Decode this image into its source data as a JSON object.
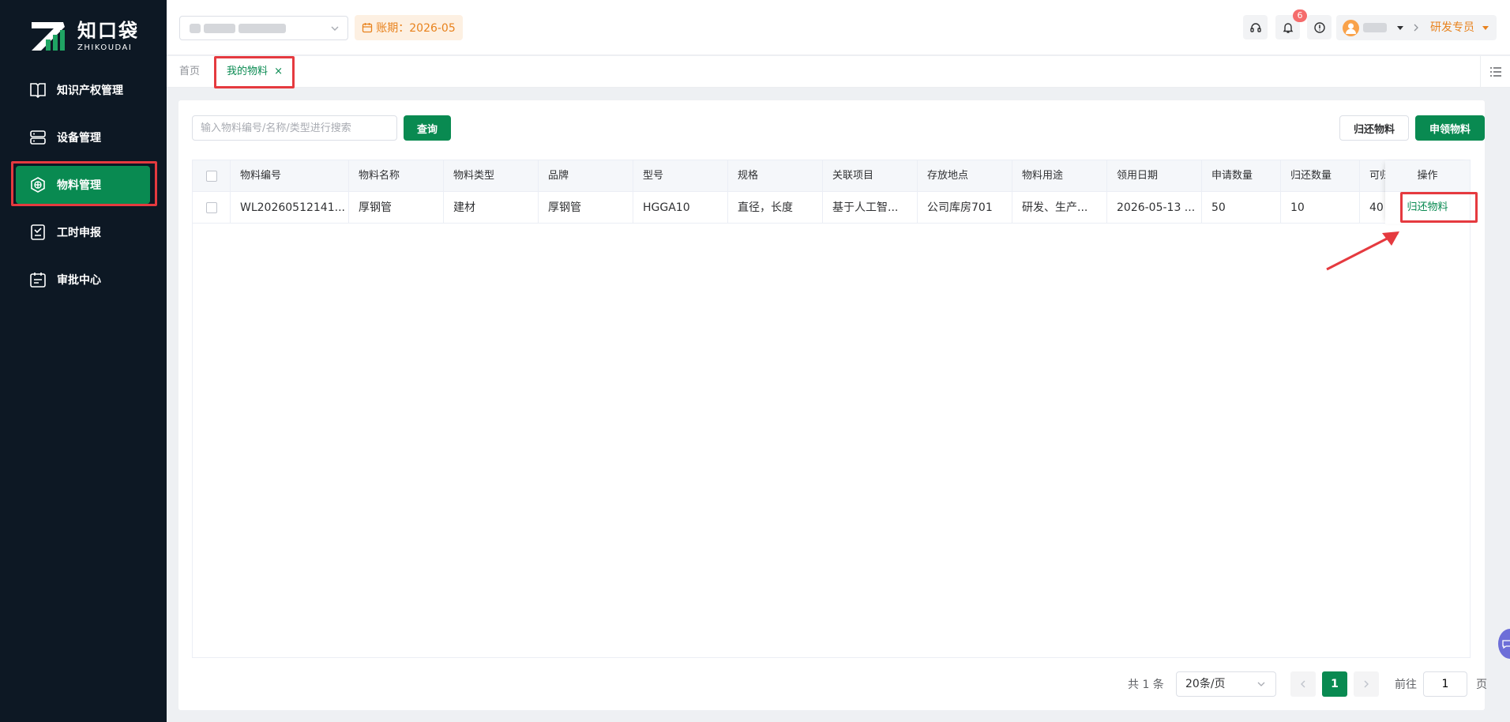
{
  "sidebar": {
    "logo_text": "知口袋",
    "logo_sub": "ZHIKOUDAI",
    "items": [
      {
        "label": "知识产权管理",
        "icon": "book-icon"
      },
      {
        "label": "设备管理",
        "icon": "server-icon"
      },
      {
        "label": "物料管理",
        "icon": "box-icon",
        "active": true
      },
      {
        "label": "工时申报",
        "icon": "clock-icon"
      },
      {
        "label": "审批中心",
        "icon": "calendar-check-icon"
      }
    ]
  },
  "header": {
    "period": "账期：2026-05",
    "notification_count": "6",
    "role": "研发专员"
  },
  "tabs": {
    "home": "首页",
    "active": "我的物料",
    "close": "×"
  },
  "toolbar": {
    "search_placeholder": "输入物料编号/名称/类型进行搜索",
    "search_button": "查询",
    "return_button": "归还物料",
    "apply_button": "申领物料"
  },
  "table": {
    "columns": [
      "物料编号",
      "物料名称",
      "物料类型",
      "品牌",
      "型号",
      "规格",
      "关联项目",
      "存放地点",
      "物料用途",
      "领用日期",
      "申请数量",
      "归还数量",
      "可归"
    ],
    "action_header": "操作",
    "rows": [
      {
        "cells": [
          "WL20260512141...",
          "厚钢管",
          "建材",
          "厚钢管",
          "HGGA10",
          "直径，长度",
          "基于人工智...",
          "公司库房701",
          "研发、生产...",
          "2026-05-13 ...",
          "50",
          "10",
          "40"
        ],
        "action": "归还物料"
      }
    ]
  },
  "pagination": {
    "total": "共 1 条",
    "page_size": "20条/页",
    "current_page": "1",
    "goto_label": "前往",
    "goto_value": "1",
    "page_suffix": "页"
  },
  "colors": {
    "primary": "#098a51",
    "sidebar_bg": "#0d1824",
    "highlight": "#e53a3f",
    "accent_orange": "#e8821d"
  }
}
